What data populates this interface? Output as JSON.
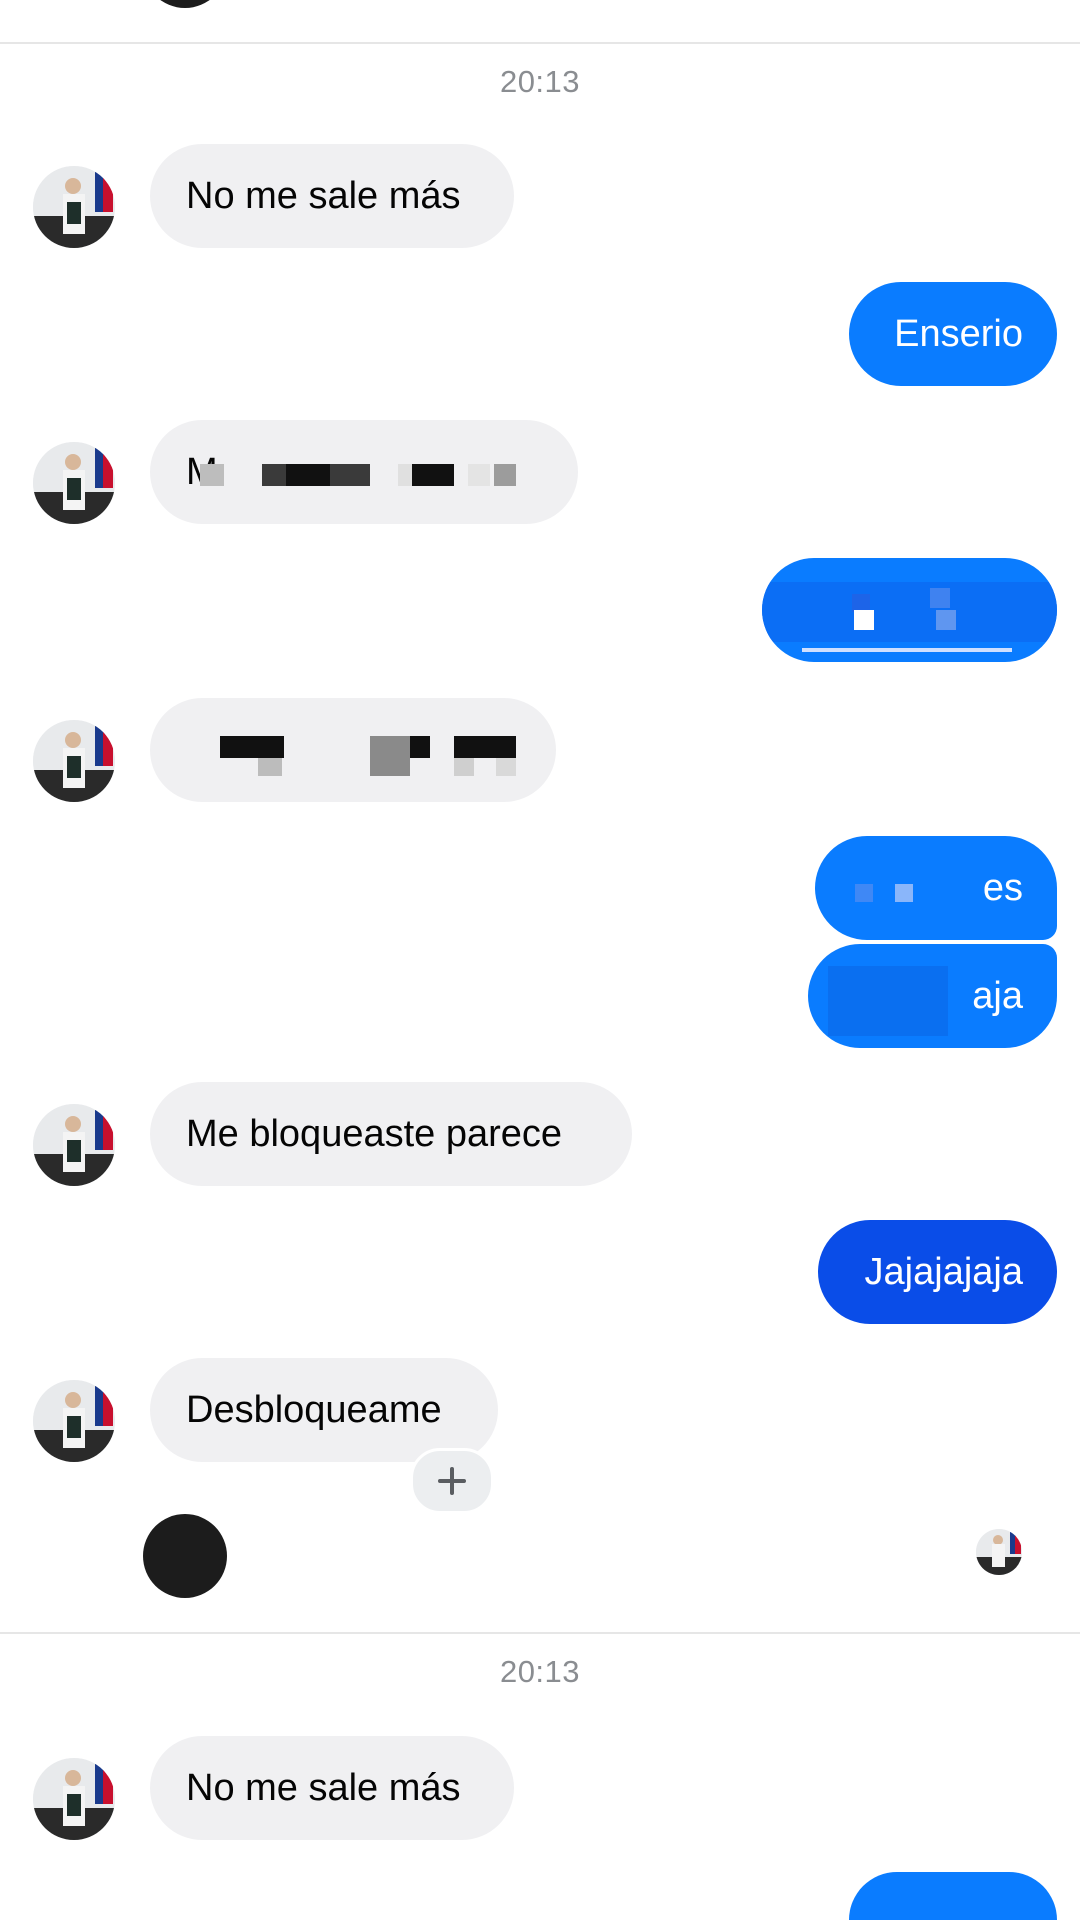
{
  "segments": [
    {
      "timestamp": "20:13",
      "messages": [
        {
          "side": "in",
          "text": "No me sale más"
        },
        {
          "side": "out",
          "text": "Enserio"
        },
        {
          "side": "in",
          "text": "M",
          "redacted": true
        },
        {
          "side": "out",
          "text": "",
          "redacted": true
        },
        {
          "side": "in",
          "text": "",
          "redacted": true
        },
        {
          "side": "out",
          "text": "es",
          "redacted": true
        },
        {
          "side": "out",
          "text": "aja",
          "redacted": true
        },
        {
          "side": "in",
          "text": "Me bloqueaste parece"
        },
        {
          "side": "out",
          "text": "Jajajajaja"
        },
        {
          "side": "in",
          "text": "Desbloqueame"
        }
      ]
    },
    {
      "timestamp": "20:13",
      "messages": [
        {
          "side": "in",
          "text": "No me sale más"
        }
      ]
    }
  ],
  "icons": {
    "add_reaction": "plus-icon",
    "contact_avatar": "avatar",
    "read_receipt": "seen-avatar"
  },
  "colors": {
    "incoming_bubble": "#f0f0f2",
    "outgoing_bubble": "#0a7cff",
    "outgoing_bubble_dark": "#0a4de8",
    "timestamp_text": "#8a8d91"
  }
}
